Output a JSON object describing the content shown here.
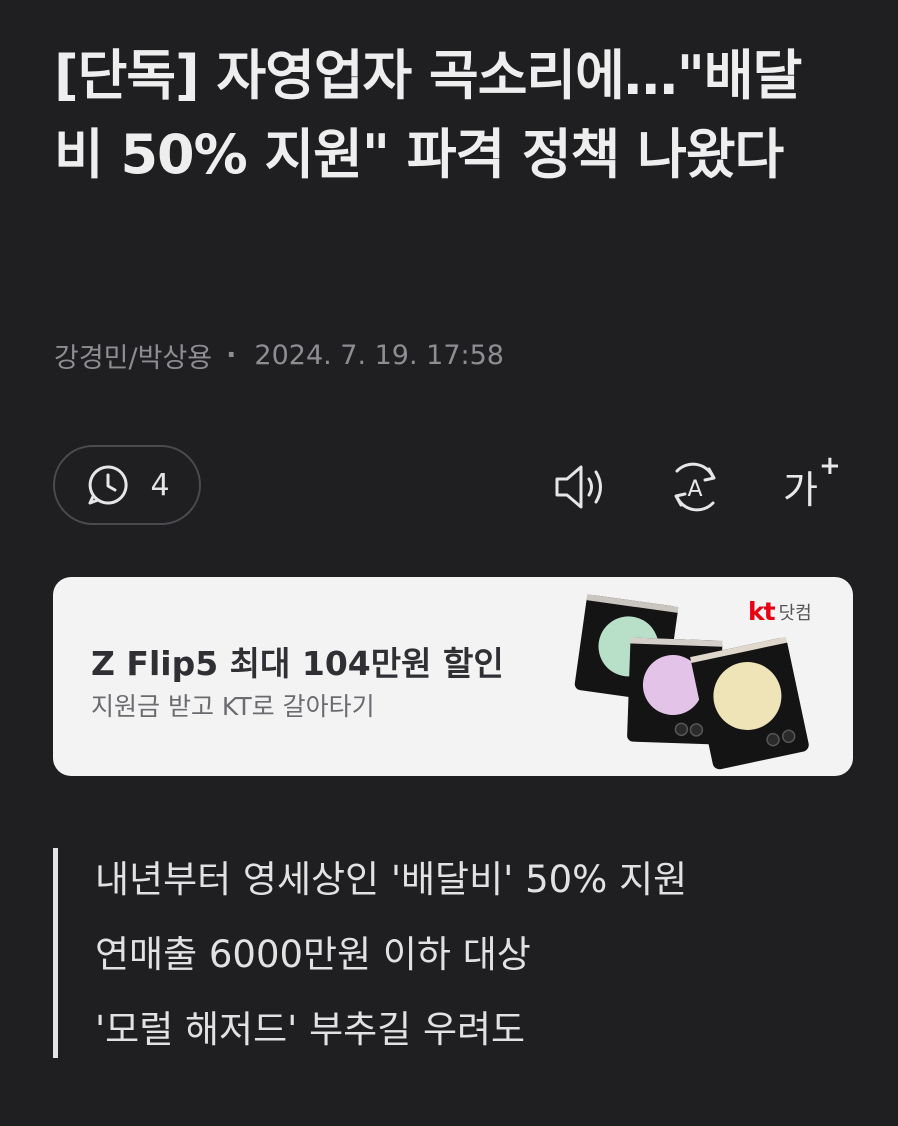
{
  "article": {
    "headline": "[단독] 자영업자 곡소리에…\"배달비 50% 지원\" 파격 정책 나왔다",
    "byline": {
      "authors": "강경민/박상용",
      "separator": "·",
      "datetime": "2024. 7. 19. 17:58"
    },
    "toolbar": {
      "comment_count": "4",
      "font_size_label": "가",
      "font_size_plus": "+",
      "icons": [
        "comment-icon",
        "speaker-icon",
        "translate-icon",
        "font-size-icon"
      ]
    },
    "ad": {
      "title": "Z Flip5 최대 104만원 할인",
      "subtitle": "지원금 받고 KT로 갈아타기",
      "brand": "kt",
      "brand_suffix": "닷컴",
      "brand_color": "#e60012",
      "phone_colors": [
        "#b8e0c8",
        "#e3c4e8",
        "#efe3b8"
      ]
    },
    "summary": [
      "내년부터 영세상인 '배달비' 50% 지원",
      "연매출 6000만원 이하 대상",
      "'모럴 해저드' 부추길 우려도"
    ]
  }
}
